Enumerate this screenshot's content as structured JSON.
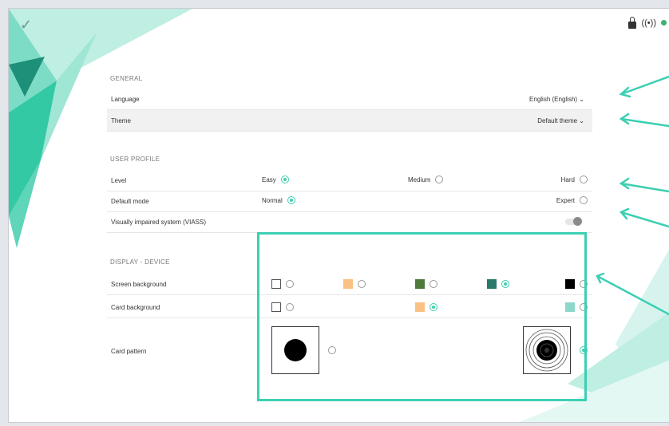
{
  "colors": {
    "accent": "#3ecfaf",
    "highlight": "#3ccfb2"
  },
  "icons": {
    "top_left": "check-icon",
    "top_right": [
      "lock-icon",
      "signal-icon"
    ]
  },
  "sections": {
    "general": {
      "title": "GENERAL",
      "language_label": "Language",
      "language_value": "English (English) ⌄",
      "theme_label": "Theme",
      "theme_value": "Default theme ⌄"
    },
    "user_profile": {
      "title": "USER PROFILE",
      "level_label": "Level",
      "level_options": [
        "Easy",
        "Medium",
        "Hard"
      ],
      "level_selected": "Easy",
      "mode_label": "Default mode",
      "mode_options": [
        "Normal",
        "Expert"
      ],
      "mode_selected": "Normal",
      "viass_label": "Visually impaired system (VIASS)"
    },
    "display": {
      "title": "DISPLAY - DEVICE",
      "screen_bg_label": "Screen background",
      "screen_bg_swatches": [
        "#ffffff",
        "#f9c284",
        "#4e7a3a",
        "#2a7a6c",
        "#000000"
      ],
      "screen_bg_selected": 3,
      "card_bg_label": "Card background",
      "card_bg_swatches": [
        "#ffffff",
        "#f9c284",
        "#8ed7cb"
      ],
      "card_bg_selected": 1,
      "card_pattern_label": "Card pattern",
      "card_pattern_options": [
        "solid-dot",
        "concentric-target"
      ],
      "card_pattern_selected": 1
    }
  }
}
